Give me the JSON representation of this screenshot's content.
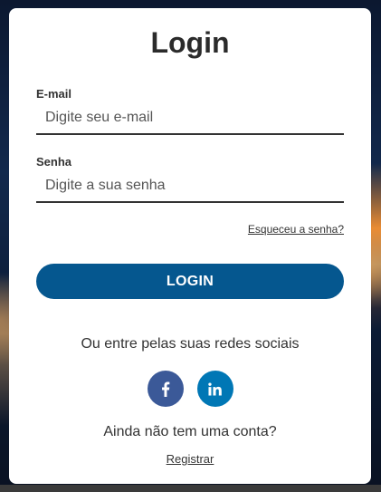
{
  "login": {
    "title": "Login",
    "email": {
      "label": "E-mail",
      "placeholder": "Digite seu e-mail",
      "value": ""
    },
    "password": {
      "label": "Senha",
      "placeholder": "Digite a sua senha",
      "value": ""
    },
    "forgot_password": "Esqueceu a senha?",
    "submit_label": "LOGIN",
    "social": {
      "prompt": "Ou entre pelas suas redes sociais",
      "networks": [
        {
          "name": "facebook",
          "icon": "facebook-icon",
          "color": "#3b5998"
        },
        {
          "name": "linkedin",
          "icon": "linkedin-icon",
          "color": "#0077b5"
        }
      ]
    },
    "no_account_text": "Ainda não tem uma conta?",
    "register_label": "Registrar"
  },
  "colors": {
    "primary_button": "#05578f",
    "card_background": "#ffffff",
    "text": "#333333"
  }
}
